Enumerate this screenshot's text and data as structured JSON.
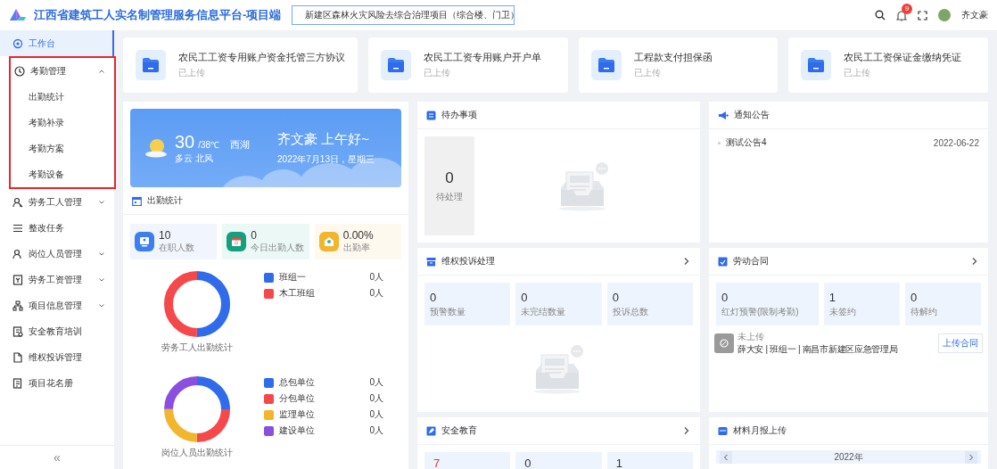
{
  "header": {
    "title": "江西省建筑工人实名制管理服务信息平台-项目端",
    "project_select": {
      "value": "新建区森林火灾风险去综合治理项目（综合楼、门卫）"
    },
    "notification_count": "9",
    "user_name": "齐文豪"
  },
  "sidebar": {
    "items": [
      {
        "label": "工作台",
        "kind": "link",
        "selected": true
      },
      {
        "label": "考勤管理",
        "kind": "group",
        "selected": false,
        "expanded": true,
        "highlighted": true,
        "children": [
          {
            "label": "出勤统计",
            "selected": false
          },
          {
            "label": "考勤补录",
            "selected": false
          },
          {
            "label": "考勤方案",
            "selected": false
          },
          {
            "label": "考勤设备",
            "selected": false
          }
        ]
      },
      {
        "label": "劳务工人管理",
        "kind": "group",
        "selected": false,
        "expanded": false,
        "highlighted": false
      },
      {
        "label": "整改任务",
        "kind": "link",
        "selected": false
      },
      {
        "label": "岗位人员管理",
        "kind": "group",
        "selected": false,
        "expanded": false,
        "highlighted": false
      },
      {
        "label": "劳务工资管理",
        "kind": "group",
        "selected": false,
        "expanded": false,
        "highlighted": false
      },
      {
        "label": "项目信息管理",
        "kind": "group",
        "selected": false,
        "expanded": false,
        "highlighted": false
      },
      {
        "label": "安全教育培训",
        "kind": "link",
        "selected": false
      },
      {
        "label": "维权投诉管理",
        "kind": "link",
        "selected": false
      },
      {
        "label": "项目花名册",
        "kind": "link",
        "selected": false
      }
    ],
    "collapse": "«"
  },
  "documents": [
    {
      "title": "农民工工资专用账户资金托管三方协议",
      "status": "已上传"
    },
    {
      "title": "农民工工资专用账户开户单",
      "status": "已上传"
    },
    {
      "title": "工程款支付担保函",
      "status": "已上传"
    },
    {
      "title": "农民工工资保证金缴纳凭证",
      "status": "已上传"
    }
  ],
  "weather": {
    "temperature": "30",
    "range": "/38℃",
    "city": "西湖",
    "condition": "多云 北风",
    "greeting": "齐文豪 上午好~",
    "date": "2022年7月13日，星期三"
  },
  "attendance": {
    "title": "出勤统计",
    "stats": [
      {
        "value": "10",
        "label": "在职人数",
        "color": "#3d7ff0"
      },
      {
        "value": "0",
        "label": "今日出勤人数",
        "color": "#13a07c"
      },
      {
        "value": "0.00%",
        "label": "出勤率",
        "color": "#f2b52e"
      }
    ],
    "charts": [
      {
        "caption": "劳务工人出勤统计",
        "legend": [
          {
            "name": "班组一",
            "value": "0人",
            "color": "#2f6bea"
          },
          {
            "name": "木工班组",
            "value": "0人",
            "color": "#f5484a"
          }
        ]
      },
      {
        "caption": "岗位人员出勤统计",
        "legend": [
          {
            "name": "总包单位",
            "value": "0人",
            "color": "#2f6bea"
          },
          {
            "name": "分包单位",
            "value": "0人",
            "color": "#f5484a"
          },
          {
            "name": "监理单位",
            "value": "0人",
            "color": "#f2b52e"
          },
          {
            "name": "建设单位",
            "value": "0人",
            "color": "#8b4fe0"
          }
        ]
      }
    ]
  },
  "todo": {
    "title": "待办事项",
    "count": "0",
    "count_label": "待处理"
  },
  "complaints": {
    "title": "维权投诉处理",
    "stats": [
      {
        "value": "0",
        "label": "预警数量"
      },
      {
        "value": "0",
        "label": "未完结数量"
      },
      {
        "value": "0",
        "label": "投诉总数"
      }
    ]
  },
  "safety": {
    "title": "安全教育",
    "stats": [
      {
        "value": "7",
        "alert": true
      },
      {
        "value": "0",
        "alert": false
      },
      {
        "value": "1",
        "alert": false
      }
    ]
  },
  "notices": {
    "title": "通知公告",
    "items": [
      {
        "title": "测试公告4",
        "date": "2022-06-22"
      }
    ]
  },
  "contracts": {
    "title": "劳动合同",
    "stats": [
      {
        "value": "0",
        "label": "红灯预警(限制考勤)"
      },
      {
        "value": "1",
        "label": "未签约"
      },
      {
        "value": "0",
        "label": "待解约"
      }
    ],
    "records": [
      {
        "status": "未上传",
        "detail": "薛大安 | 班组一 | 南昌市新建区应急管理局",
        "action": "上传合同"
      }
    ]
  },
  "materials": {
    "title": "材料月报上传",
    "year": "2022年"
  }
}
